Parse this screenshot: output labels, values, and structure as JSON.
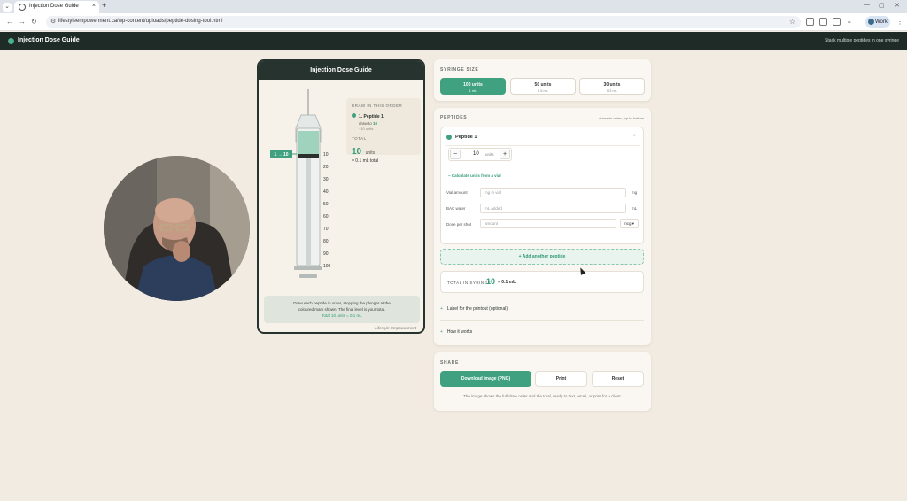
{
  "browser": {
    "tab_title": "Injection Dose Guide",
    "url": "lifestyleempowerment.ca/wp-content/uploads/peptide-dosing-tool.html",
    "profile": "Work"
  },
  "app": {
    "name": "Injection Dose Guide",
    "tagline": "Stack multiple peptides in one syringe"
  },
  "preview": {
    "title": "Injection Dose Guide",
    "marker_label": "1 → 10",
    "ticks": [
      "10",
      "20",
      "30",
      "40",
      "50",
      "60",
      "70",
      "80",
      "90",
      "100"
    ],
    "fill_fraction": 0.1,
    "draw_order": {
      "heading": "DRAW IN THIS ORDER",
      "item_label": "1. Peptide 1",
      "draw_to_prefix": "draw to",
      "draw_to_value": "10",
      "units_note": "+10 units",
      "total_label": "TOTAL",
      "total_value": "10",
      "total_unit": "units",
      "total_ml": "= 0.1 mL total"
    },
    "note_line1": "Draw each peptide in order, stopping the plunger at the",
    "note_line2": "coloured mark shown. The final level is your total.",
    "note_total": "Total 10 units = 0.1 mL",
    "brand": "Lifestyle Empowerment"
  },
  "syringe_size": {
    "label": "SYRINGE SIZE",
    "options": [
      {
        "title": "100 units",
        "sub": "1 mL"
      },
      {
        "title": "50 units",
        "sub": "0.5 mL"
      },
      {
        "title": "30 units",
        "sub": "0.3 mL"
      }
    ]
  },
  "peptides": {
    "label": "PEPTIDES",
    "hint": "drawn in order, top to bottom",
    "item": {
      "name": "Peptide 1",
      "remove": "×",
      "units_value": "10",
      "units_label": "units",
      "minus": "−",
      "plus": "+",
      "calc_toggle": "−  Calculate units from a vial",
      "vial_amount_label": "Vial amount",
      "vial_amount_placeholder": "mg in vial",
      "vial_amount_unit": "mg",
      "bac_label": "BAC water",
      "bac_placeholder": "mL added",
      "bac_unit": "mL",
      "dose_label": "Dose per shot",
      "dose_placeholder": "amount",
      "dose_unit": "mcg"
    },
    "add_button": "+ Add another peptide",
    "total_label": "TOTAL IN SYRINGE",
    "total_value": "10",
    "total_ml": "= 0.1 mL",
    "label_toggle": "Label for the printout (optional)",
    "how_toggle": "How it works"
  },
  "share": {
    "label": "SHARE",
    "download": "Download image (PNG)",
    "print": "Print",
    "reset": "Reset",
    "note": "The image shows the full draw order and the total, ready to text, email, or print for a client."
  },
  "colors": {
    "accent": "#3fa17f",
    "dark": "#1f2b27",
    "bg": "#f2ebe1"
  }
}
